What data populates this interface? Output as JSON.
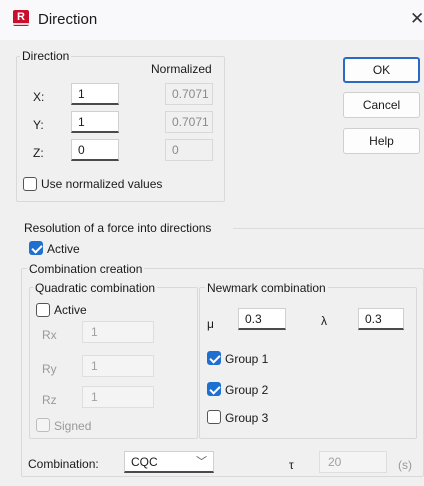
{
  "window": {
    "title": "Direction",
    "icon_letter": "R"
  },
  "direction": {
    "legend": "Direction",
    "normalized_header": "Normalized",
    "x": {
      "label": "X:",
      "value": "1",
      "normalized": "0.7071"
    },
    "y": {
      "label": "Y:",
      "value": "1",
      "normalized": "0.7071"
    },
    "z": {
      "label": "Z:",
      "value": "0",
      "normalized": "0"
    },
    "use_normalized_label": "Use normalized values",
    "use_normalized_checked": false
  },
  "buttons": {
    "ok": "OK",
    "cancel": "Cancel",
    "help": "Help"
  },
  "resolution": {
    "legend": "Resolution of a force into directions",
    "active_label": "Active",
    "active_checked": true
  },
  "combination_creation": {
    "legend": "Combination creation",
    "quadratic": {
      "legend": "Quadratic combination",
      "active_label": "Active",
      "active_checked": false,
      "rx": {
        "label": "Rx",
        "value": "1"
      },
      "ry": {
        "label": "Ry",
        "value": "1"
      },
      "rz": {
        "label": "Rz",
        "value": "1"
      },
      "signed_label": "Signed",
      "signed_checked": false
    },
    "newmark": {
      "legend": "Newmark combination",
      "mu_label": "μ",
      "mu_value": "0.3",
      "lambda_label": "λ",
      "lambda_value": "0.3",
      "group1_label": "Group 1",
      "group1_checked": true,
      "group2_label": "Group 2",
      "group2_checked": true,
      "group3_label": "Group 3",
      "group3_checked": false
    },
    "combination_label": "Combination:",
    "combination_value": "CQC",
    "tau_label": "τ",
    "tau_value": "20",
    "tau_unit": "(s)"
  },
  "colors": {
    "accent": "#1f6fd0",
    "app_icon": "#c8102e"
  }
}
